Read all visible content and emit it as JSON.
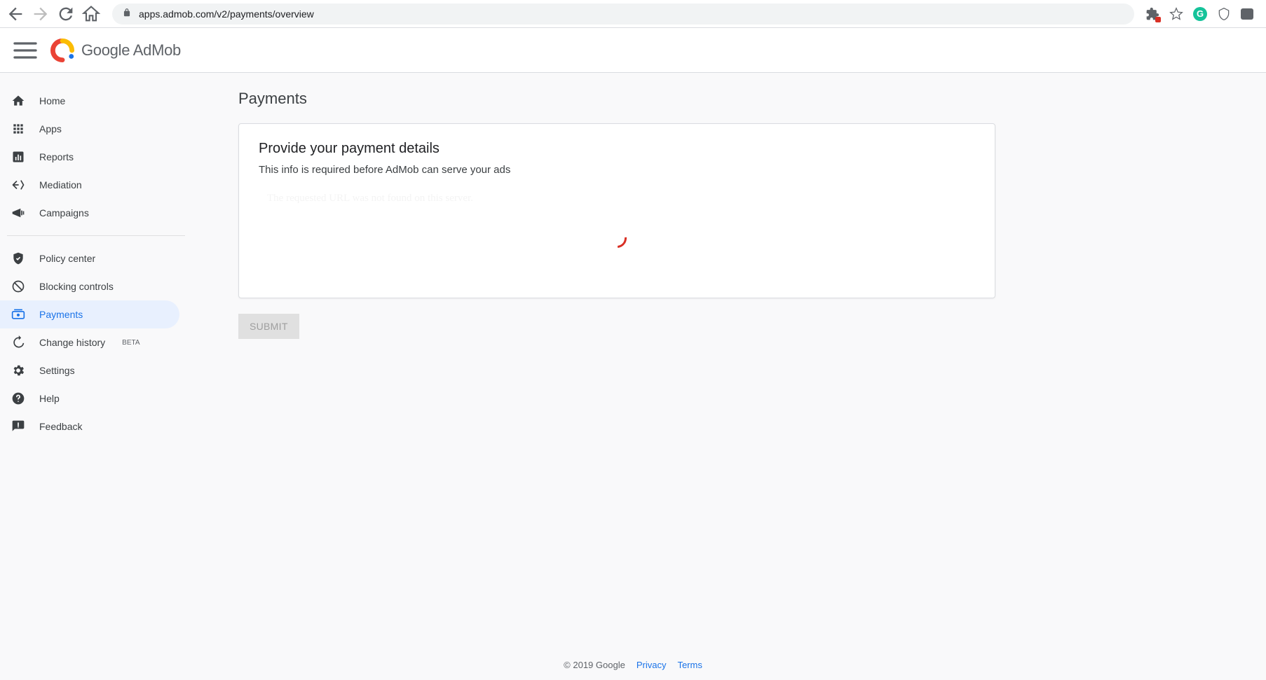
{
  "browser": {
    "url": "apps.admob.com/v2/payments/overview"
  },
  "brand": {
    "google": "Google",
    "admob": "AdMob"
  },
  "sidebar": {
    "home": "Home",
    "apps": "Apps",
    "reports": "Reports",
    "mediation": "Mediation",
    "campaigns": "Campaigns",
    "policy": "Policy center",
    "blocking": "Blocking controls",
    "payments": "Payments",
    "history": "Change history",
    "history_badge": "BETA",
    "settings": "Settings",
    "help": "Help",
    "feedback": "Feedback"
  },
  "page": {
    "title": "Payments",
    "card_title": "Provide your payment details",
    "card_subtitle": "This info is required before AdMob can serve your ads",
    "error_text": "The requested URL was not found on this server.",
    "submit": "SUBMIT"
  },
  "footer": {
    "copyright": "© 2019 Google",
    "privacy": "Privacy",
    "terms": "Terms"
  }
}
